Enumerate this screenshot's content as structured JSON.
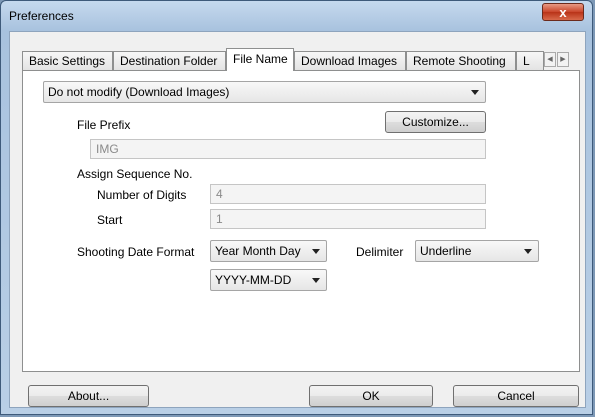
{
  "window": {
    "title": "Preferences",
    "close_glyph": "x"
  },
  "tabs": [
    {
      "label": "Basic Settings",
      "active": false
    },
    {
      "label": "Destination Folder",
      "active": false
    },
    {
      "label": "File Name",
      "active": true
    },
    {
      "label": "Download Images",
      "active": false
    },
    {
      "label": "Remote Shooting",
      "active": false
    },
    {
      "label": "L",
      "active": false
    }
  ],
  "tab_scroll": {
    "left": "◀",
    "right": "▶"
  },
  "file_name": {
    "mode_select": "Do not modify (Download Images)",
    "customize_button": "Customize...",
    "file_prefix_label": "File Prefix",
    "file_prefix_value": "IMG",
    "assign_sequence_label": "Assign Sequence No.",
    "number_of_digits_label": "Number of Digits",
    "number_of_digits_value": "4",
    "start_label": "Start",
    "start_value": "1",
    "shooting_date_format_label": "Shooting Date Format",
    "date_order_select": "Year Month Day",
    "delimiter_label": "Delimiter",
    "delimiter_select": "Underline",
    "date_pattern_select": "YYYY-MM-DD"
  },
  "footer": {
    "about_button": "About...",
    "ok_button": "OK",
    "cancel_button": "Cancel"
  }
}
